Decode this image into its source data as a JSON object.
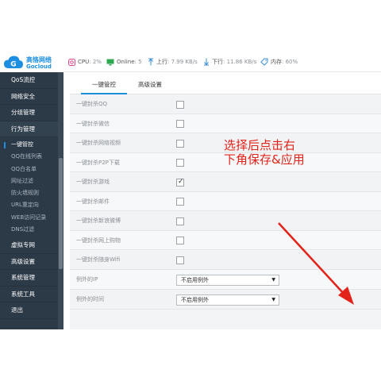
{
  "logo": {
    "name_cn": "高恪网络",
    "name_en": "Gocloud"
  },
  "status": {
    "cpu_label": "CPU",
    "cpu_value": ": 2%",
    "online_label": "Online",
    "online_value": ": 5",
    "up_label": "上行",
    "up_value": ": 7.99 KB/s",
    "down_label": "下行",
    "down_value": ": 11.86 KB/s",
    "mem_label": "内存",
    "mem_value": ": 60%"
  },
  "sidebar": {
    "items_top": [
      {
        "label": "QoS流控"
      },
      {
        "label": "网络安全"
      },
      {
        "label": "分组管理"
      },
      {
        "label": "行为管理"
      }
    ],
    "sub_items": [
      {
        "label": "一键管控"
      },
      {
        "label": "QQ在线列表"
      },
      {
        "label": "QQ白名单"
      },
      {
        "label": "网址过滤"
      },
      {
        "label": "防火墙规则"
      },
      {
        "label": "URL重定向"
      },
      {
        "label": "WEB访问记录"
      },
      {
        "label": "DNS过滤"
      }
    ],
    "items_bottom": [
      {
        "label": "虚拟专网"
      },
      {
        "label": "高级设置"
      },
      {
        "label": "系统管理"
      },
      {
        "label": "系统工具"
      },
      {
        "label": "退出"
      }
    ]
  },
  "tabs": [
    {
      "label": "一键管控"
    },
    {
      "label": "高级设置"
    }
  ],
  "options": [
    {
      "label": "一键封杀QQ",
      "checked": false
    },
    {
      "label": "一键封杀微信",
      "checked": false
    },
    {
      "label": "一键封杀网络视频",
      "checked": false
    },
    {
      "label": "一键封杀P2P下载",
      "checked": false
    },
    {
      "label": "一键封杀游戏",
      "checked": true
    },
    {
      "label": "一键封杀邮件",
      "checked": false
    },
    {
      "label": "一键封杀新浪微博",
      "checked": false
    },
    {
      "label": "一键封杀网上购物",
      "checked": false
    },
    {
      "label": "一键封杀随身Wifi",
      "checked": false
    }
  ],
  "exceptions": [
    {
      "label": "例外的IP",
      "value": "不启用例外"
    },
    {
      "label": "例外的时间",
      "value": "不启用例外"
    }
  ],
  "annotation": {
    "line1": "选择后点击右",
    "line2": "下角保存&应用",
    "color": "#e2231a"
  },
  "colors": {
    "sidebar_bg": "#2c3a48",
    "accent": "#1d8fe1"
  }
}
